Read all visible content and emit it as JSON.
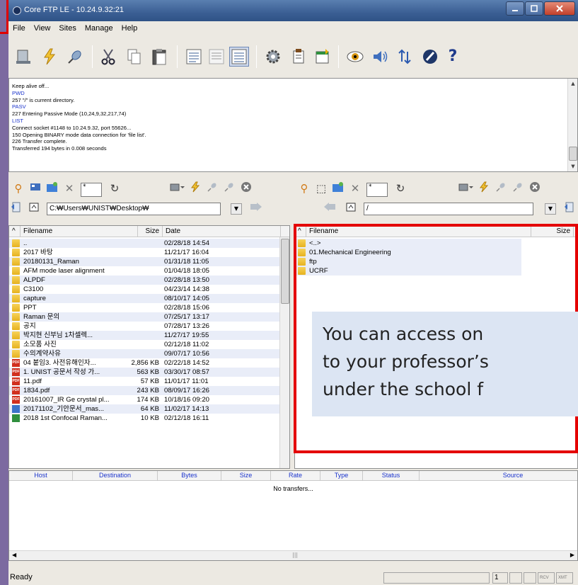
{
  "window": {
    "title": "Core FTP LE - 10.24.9.32:21"
  },
  "menu": [
    "File",
    "View",
    "Sites",
    "Manage",
    "Help"
  ],
  "toolbar_icons": [
    "site-manager-icon",
    "connect-icon",
    "disconnect-icon",
    "cut-icon",
    "copy-icon",
    "paste-icon",
    "view-text-icon",
    "view-list-icon",
    "view-details-icon",
    "settings-icon",
    "properties-icon",
    "transfer-icon",
    "view-icon",
    "sound-icon",
    "sync-icon",
    "about-icon",
    "help-icon"
  ],
  "log": [
    {
      "t": "Keep alive off...",
      "c": false
    },
    {
      "t": "PWD",
      "c": true
    },
    {
      "t": "257 \"/\" is current directory.",
      "c": false
    },
    {
      "t": "PASV",
      "c": true
    },
    {
      "t": "227 Entering Passive Mode (10,24,9,32,217,74)",
      "c": false
    },
    {
      "t": "LIST",
      "c": true
    },
    {
      "t": "Connect socket #1148 to 10.24.9.32, port 55626...",
      "c": false
    },
    {
      "t": "150 Opening BINARY mode data connection for 'file list'.",
      "c": false
    },
    {
      "t": "226 Transfer complete.",
      "c": false
    },
    {
      "t": "Transferred 194 bytes in 0.008 seconds",
      "c": false
    }
  ],
  "left": {
    "filter": "*",
    "path": "C:₩Users₩UNIST₩Desktop₩",
    "headers": {
      "filename": "Filename",
      "size": "Size",
      "date": "Date"
    },
    "files": [
      {
        "name": "..",
        "size": "",
        "date": "02/28/18  14:54",
        "icon": "folder"
      },
      {
        "name": "2017 바탕",
        "size": "",
        "date": "11/21/17  16:04",
        "icon": "folder"
      },
      {
        "name": "20180131_Raman",
        "size": "",
        "date": "01/31/18  11:05",
        "icon": "folder"
      },
      {
        "name": "AFM mode laser alignment",
        "size": "",
        "date": "01/04/18  18:05",
        "icon": "folder"
      },
      {
        "name": "ALPDF",
        "size": "",
        "date": "02/28/18  13:50",
        "icon": "folder"
      },
      {
        "name": "C3100",
        "size": "",
        "date": "04/23/14  14:38",
        "icon": "folder"
      },
      {
        "name": "capture",
        "size": "",
        "date": "08/10/17  14:05",
        "icon": "folder"
      },
      {
        "name": "PPT",
        "size": "",
        "date": "02/28/18  15:06",
        "icon": "folder"
      },
      {
        "name": "Raman 문의",
        "size": "",
        "date": "07/25/17  13:17",
        "icon": "folder"
      },
      {
        "name": "공지",
        "size": "",
        "date": "07/28/17  13:26",
        "icon": "folder"
      },
      {
        "name": "박지현 신부님 1차셀렉...",
        "size": "",
        "date": "11/27/17  19:55",
        "icon": "folder"
      },
      {
        "name": "소모품 사진",
        "size": "",
        "date": "02/12/18  11:02",
        "icon": "folder"
      },
      {
        "name": "수의계약사유",
        "size": "",
        "date": "09/07/17  10:56",
        "icon": "folder"
      },
      {
        "name": "04 붙임3. 사전유해인자...",
        "size": "2,856 KB",
        "date": "02/22/18  14:52",
        "icon": "pdf"
      },
      {
        "name": "1. UNIST 공문서 작성 가...",
        "size": "563 KB",
        "date": "03/30/17  08:57",
        "icon": "pdf"
      },
      {
        "name": "11.pdf",
        "size": "57 KB",
        "date": "11/01/17  11:01",
        "icon": "pdf"
      },
      {
        "name": "1834.pdf",
        "size": "243 KB",
        "date": "08/09/17  16:26",
        "icon": "pdf"
      },
      {
        "name": "20161007_IR Ge crystal pl...",
        "size": "174 KB",
        "date": "10/18/16  09:20",
        "icon": "pdf"
      },
      {
        "name": "20171102_기안문서_mas...",
        "size": "64 KB",
        "date": "11/02/17  14:13",
        "icon": "doc"
      },
      {
        "name": "2018 1st Confocal Raman...",
        "size": "10 KB",
        "date": "02/12/18  16:11",
        "icon": "xls"
      }
    ]
  },
  "right": {
    "filter": "*",
    "path": "/",
    "headers": {
      "filename": "Filename",
      "size": "Size"
    },
    "files": [
      {
        "name": "<..>",
        "icon": "folder"
      },
      {
        "name": "01.Mechanical Engineering",
        "icon": "folder"
      },
      {
        "name": "ftp",
        "icon": "folder"
      },
      {
        "name": "UCRF",
        "icon": "folder"
      }
    ]
  },
  "queue": {
    "headers": [
      "Host",
      "Destination",
      "Bytes",
      "Size",
      "Rate",
      "Type",
      "Status",
      "Source"
    ],
    "empty": "No transfers..."
  },
  "status": {
    "text": "Ready",
    "page": "1",
    "rcv": "RCV",
    "xmt": "XMT"
  },
  "callout": {
    "lines": [
      "You can access on",
      "to your professor’s",
      "under the school f"
    ]
  },
  "colors": {
    "title_bar": "#3b5f94",
    "highlight": "#e1e8f8",
    "callout_border": "#e40000",
    "callout_fill": "#dce5f3",
    "log_command": "#1a33cc"
  }
}
